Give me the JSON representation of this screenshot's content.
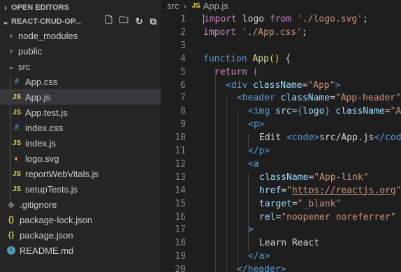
{
  "explorer": {
    "section_title": "OPEN EDITORS",
    "project_title": "REACT-CRUD-OP...",
    "items": [
      {
        "label": "node_modules",
        "kind": "folder",
        "expanded": false,
        "level": 0
      },
      {
        "label": "public",
        "kind": "folder",
        "expanded": false,
        "level": 0
      },
      {
        "label": "src",
        "kind": "folder",
        "expanded": true,
        "level": 0
      },
      {
        "label": "App.css",
        "kind": "css",
        "level": 1
      },
      {
        "label": "App.js",
        "kind": "js",
        "level": 1,
        "active": true
      },
      {
        "label": "App.test.js",
        "kind": "js",
        "level": 1
      },
      {
        "label": "index.css",
        "kind": "css",
        "level": 1
      },
      {
        "label": "index.js",
        "kind": "js",
        "level": 1
      },
      {
        "label": "logo.svg",
        "kind": "svg",
        "level": 1
      },
      {
        "label": "reportWebVitals.js",
        "kind": "js",
        "level": 1
      },
      {
        "label": "setupTests.js",
        "kind": "js",
        "level": 1
      },
      {
        "label": ".gitignore",
        "kind": "git",
        "level": 0
      },
      {
        "label": "package-lock.json",
        "kind": "json",
        "level": 0
      },
      {
        "label": "package.json",
        "kind": "json",
        "level": 0
      },
      {
        "label": "README.md",
        "kind": "info",
        "level": 0
      }
    ],
    "icons": {
      "js": "JS",
      "css": "#",
      "json": "{}",
      "svg": "svg-icon",
      "git": "diamond-icon",
      "info": "i"
    }
  },
  "breadcrumb": {
    "folder": "src",
    "file": "App.js",
    "file_icon": "JS"
  },
  "code_lines": [
    {
      "n": "1"
    },
    {
      "n": "2"
    },
    {
      "n": "3"
    },
    {
      "n": "4"
    },
    {
      "n": "5"
    },
    {
      "n": "6"
    },
    {
      "n": "7"
    },
    {
      "n": "8"
    },
    {
      "n": "9"
    },
    {
      "n": "10"
    },
    {
      "n": "11"
    },
    {
      "n": "12"
    },
    {
      "n": "13"
    },
    {
      "n": "14"
    },
    {
      "n": "15"
    },
    {
      "n": "16"
    },
    {
      "n": "17"
    },
    {
      "n": "18"
    },
    {
      "n": "19"
    },
    {
      "n": "20"
    }
  ],
  "code": {
    "l1": [
      "import",
      " logo ",
      "from",
      " ",
      "'./logo.svg'",
      ";"
    ],
    "l2": [
      "import",
      " ",
      "'./App.css'",
      ";"
    ],
    "l4": [
      "function",
      " ",
      "App",
      "()",
      " {"
    ],
    "l5": [
      "return",
      " ("
    ],
    "l6": [
      "<",
      "div",
      " ",
      "className",
      "=",
      "\"App\"",
      ">"
    ],
    "l7": [
      "<",
      "header",
      " ",
      "className",
      "=",
      "\"App-header\"",
      ">"
    ],
    "l8": [
      "<",
      "img",
      " ",
      "src",
      "=",
      "{",
      "logo",
      "}",
      " ",
      "className",
      "=",
      "\"Ap"
    ],
    "l9": [
      "<",
      "p",
      ">"
    ],
    "l10": [
      "Edit ",
      "<",
      "code",
      ">",
      "src/App.js",
      "</",
      "code"
    ],
    "l11": [
      "</",
      "p",
      ">"
    ],
    "l12": [
      "<",
      "a"
    ],
    "l13": [
      "className",
      "=",
      "\"App-link\""
    ],
    "l14": [
      "href",
      "=",
      "\"",
      "https://reactjs.org",
      "\""
    ],
    "l15": [
      "target",
      "=",
      "\"_blank\""
    ],
    "l16": [
      "rel",
      "=",
      "\"noopener noreferrer\""
    ],
    "l17": [
      ">"
    ],
    "l18": [
      "Learn React"
    ],
    "l19": [
      "</",
      "a",
      ">"
    ],
    "l20": [
      "</",
      "header",
      ">"
    ]
  },
  "colors": {
    "keyword": "#c586c0",
    "function": "#dcdcaa",
    "string": "#ce9178",
    "tag": "#569cd6",
    "attribute": "#9cdcfe",
    "text": "#d4d4d4",
    "line_number": "#858585",
    "sidebar_bg": "#252526",
    "editor_bg": "#1e1e1e"
  }
}
